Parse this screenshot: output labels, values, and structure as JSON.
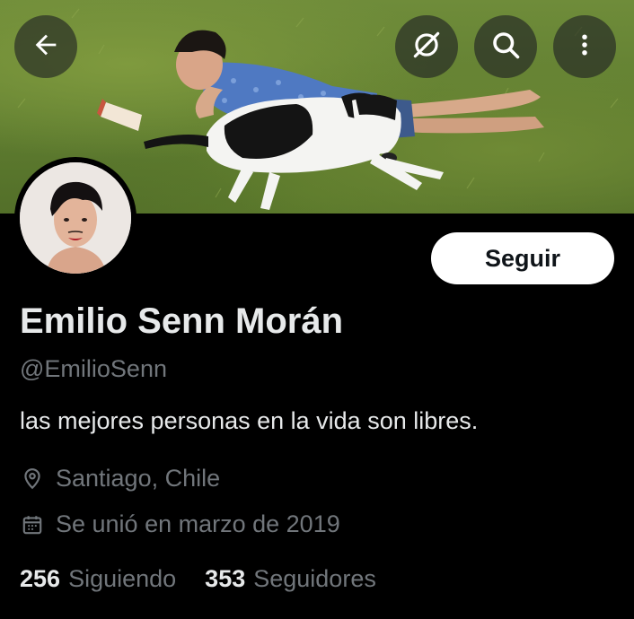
{
  "header": {
    "back_icon": "arrow-left-icon",
    "grok_icon": "grok-slash-circle-icon",
    "search_icon": "search-icon",
    "more_icon": "more-vertical-icon"
  },
  "profile": {
    "display_name": "Emilio Senn Morán",
    "handle": "@EmilioSenn",
    "bio": "las mejores personas en la vida son libres.",
    "location": "Santiago, Chile",
    "joined": "Se unió en marzo de 2019",
    "following_count": "256",
    "following_label": "Siguiendo",
    "followers_count": "353",
    "followers_label": "Seguidores"
  },
  "actions": {
    "follow_label": "Seguir"
  },
  "colors": {
    "background": "#000000",
    "primary_text": "#e7e9ea",
    "secondary_text": "#71767b",
    "button_bg": "#ffffff"
  }
}
